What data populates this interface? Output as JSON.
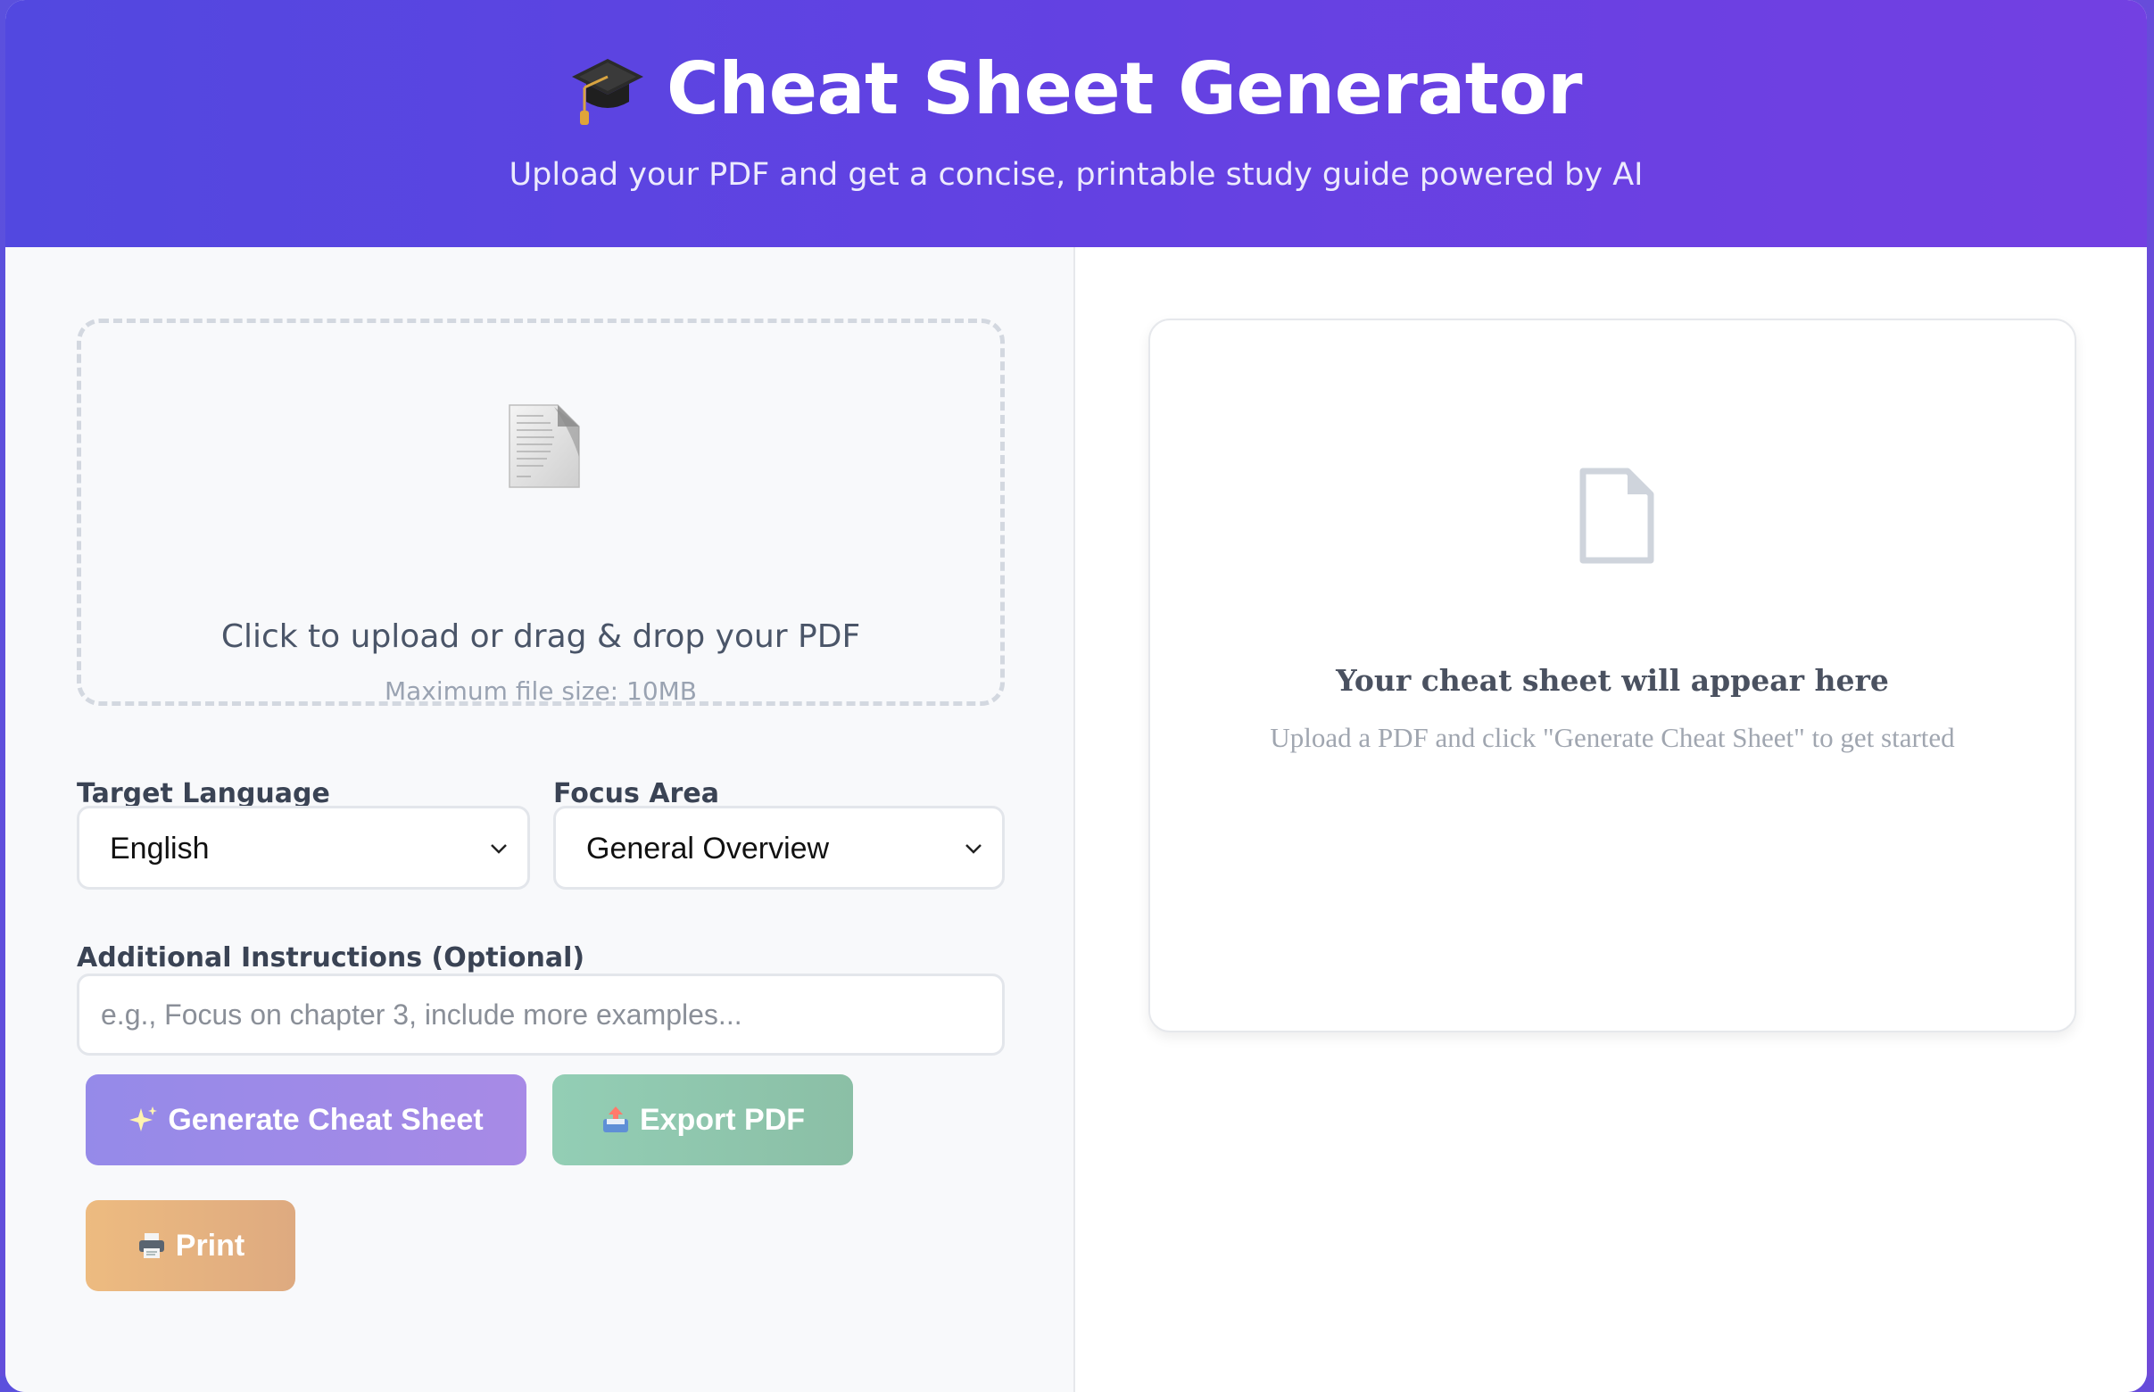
{
  "header": {
    "icon": "graduation-cap-icon",
    "title": "Cheat Sheet Generator",
    "subtitle": "Upload your PDF and get a concise, printable study guide powered by AI"
  },
  "upload": {
    "icon": "document-icon",
    "text": "Click to upload or drag & drop your PDF",
    "subtext": "Maximum file size: 10MB"
  },
  "options": {
    "language_label": "Target Language",
    "language_value": "English",
    "focus_label": "Focus Area",
    "focus_value": "General Overview",
    "instructions_label": "Additional Instructions (Optional)",
    "instructions_placeholder": "e.g., Focus on chapter 3, include more examples...",
    "instructions_value": ""
  },
  "buttons": {
    "generate": {
      "icon": "sparkles-icon",
      "label": "Generate Cheat Sheet"
    },
    "export": {
      "icon": "inbox-tray-icon",
      "label": "Export PDF"
    },
    "print": {
      "icon": "printer-icon",
      "label": "Print"
    }
  },
  "preview": {
    "icon": "file-icon",
    "title": "Your cheat sheet will appear here",
    "subtitle": "Upload a PDF and click \"Generate Cheat Sheet\" to get started"
  },
  "colors": {
    "header_start": "#5248e0",
    "header_end": "#7340e2",
    "generate_button": "#958ae9",
    "export_button": "#93ceb5",
    "print_button": "#edbb80"
  }
}
